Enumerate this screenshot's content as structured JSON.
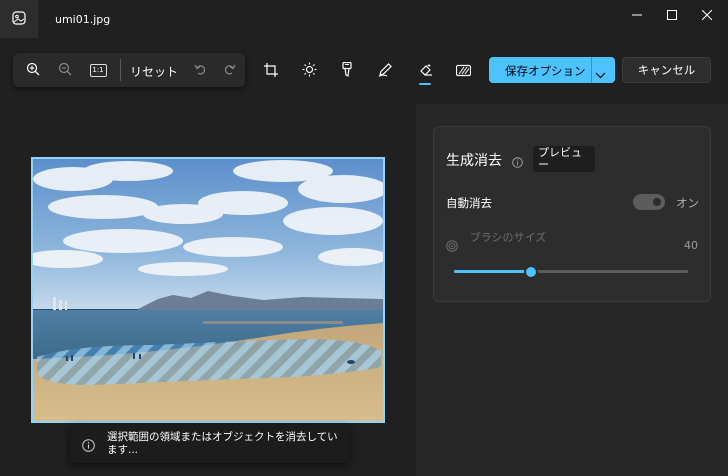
{
  "titlebar": {
    "filename": "umi01.jpg"
  },
  "toolbar": {
    "reset_label": "リセット",
    "save_label": "保存オプション",
    "cancel_label": "キャンセル",
    "fit_icon_text": "1:1"
  },
  "panel": {
    "title": "生成消去",
    "preview_badge": "プレビュー",
    "auto_erase_label": "自動消去",
    "auto_erase_state": "オン",
    "brush_size_label": "ブラシのサイズ",
    "brush_size_value": "40",
    "brush_size_level": 0.33
  },
  "toast": {
    "message": "選択範囲の領域またはオブジェクトを消去しています..."
  },
  "colors": {
    "accent": "#4cc2ff",
    "background": "#202020",
    "panel": "#2d2d2d",
    "selection_frame": "#8fd3ff"
  },
  "icons": [
    "photos-app-icon",
    "minimize-icon",
    "maximize-icon",
    "close-icon",
    "zoom-in-icon",
    "zoom-out-icon",
    "actual-size-icon",
    "undo-icon",
    "redo-icon",
    "crop-icon",
    "adjust-brightness-icon",
    "filter-icon",
    "markup-pen-icon",
    "generative-erase-icon",
    "blur-background-icon",
    "chevron-down-icon",
    "info-icon",
    "brush-size-icon"
  ]
}
